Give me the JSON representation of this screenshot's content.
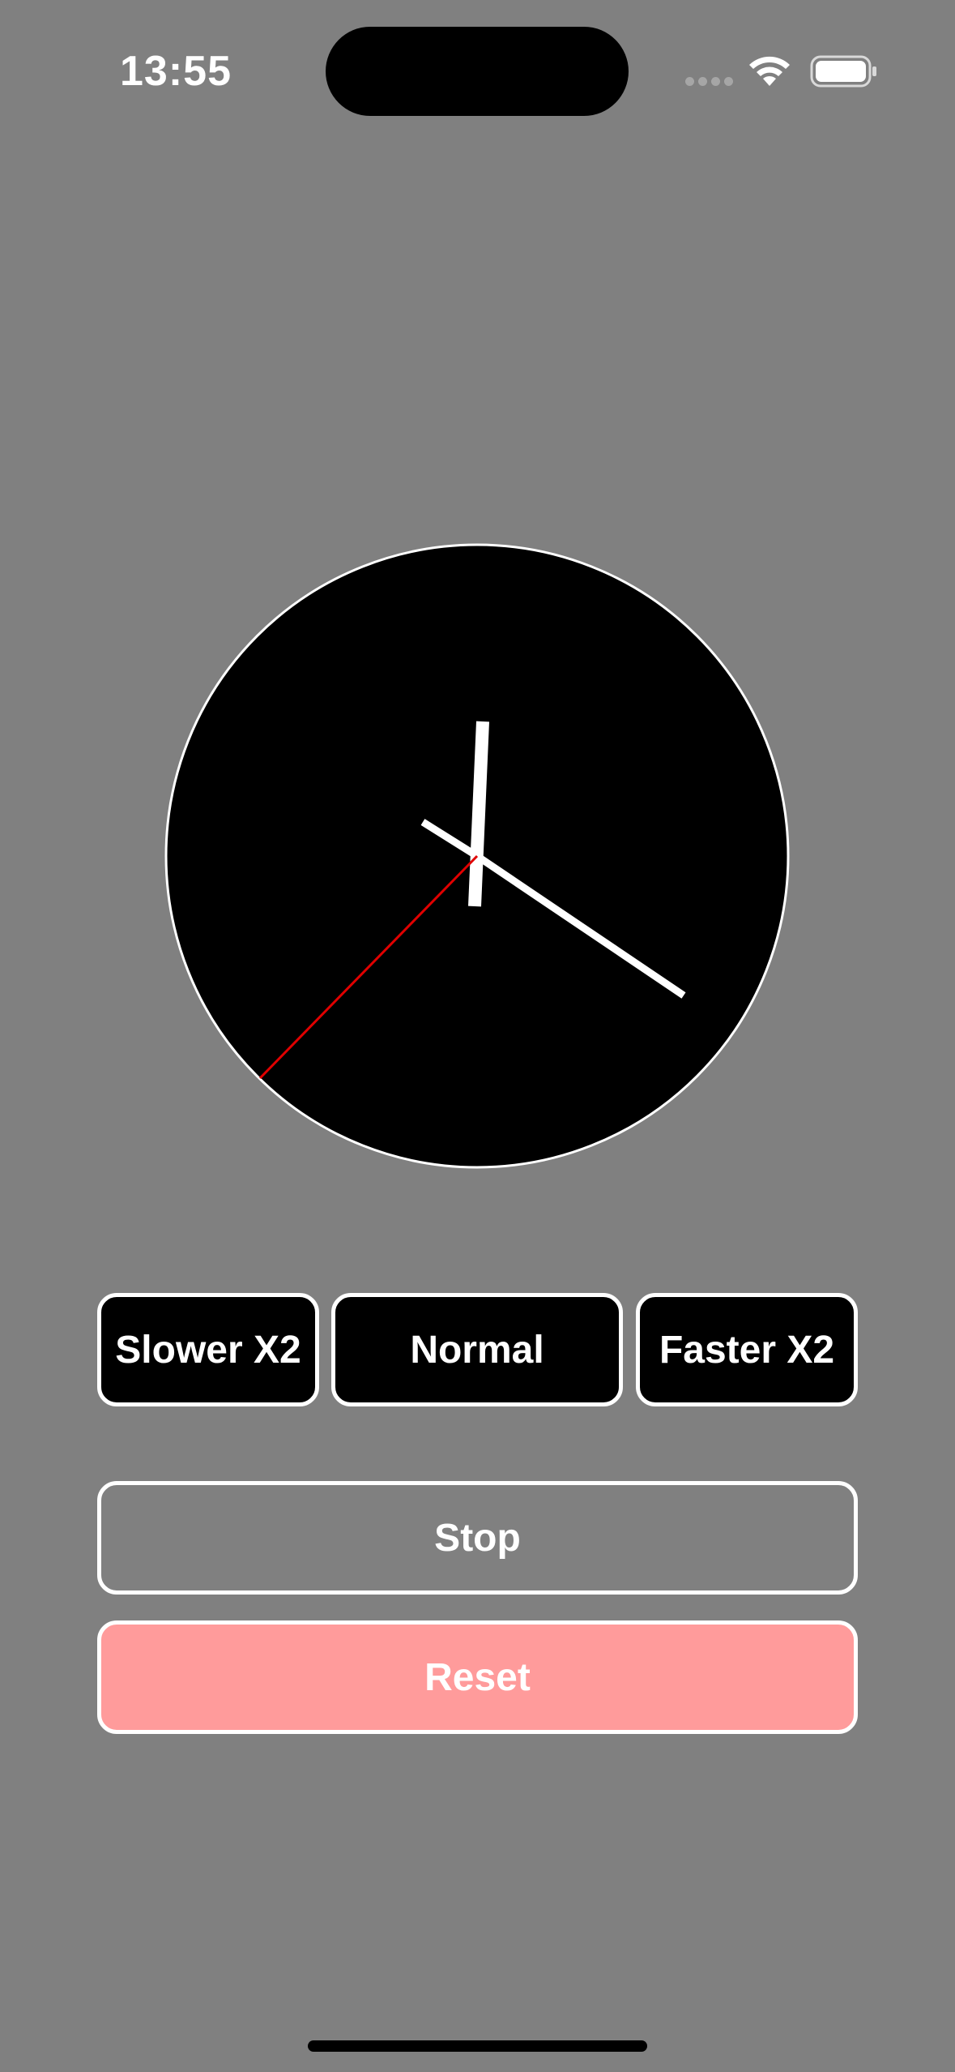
{
  "status_bar": {
    "time": "13:55"
  },
  "clock": {
    "face_color": "#000000",
    "hand_color": "#ffffff",
    "second_hand_color": "#e00000"
  },
  "speed_controls": {
    "slower_label": "Slower X2",
    "normal_label": "Normal",
    "faster_label": "Faster X2"
  },
  "actions": {
    "stop_label": "Stop",
    "reset_label": "Reset",
    "reset_color": "#ff9b9b"
  }
}
